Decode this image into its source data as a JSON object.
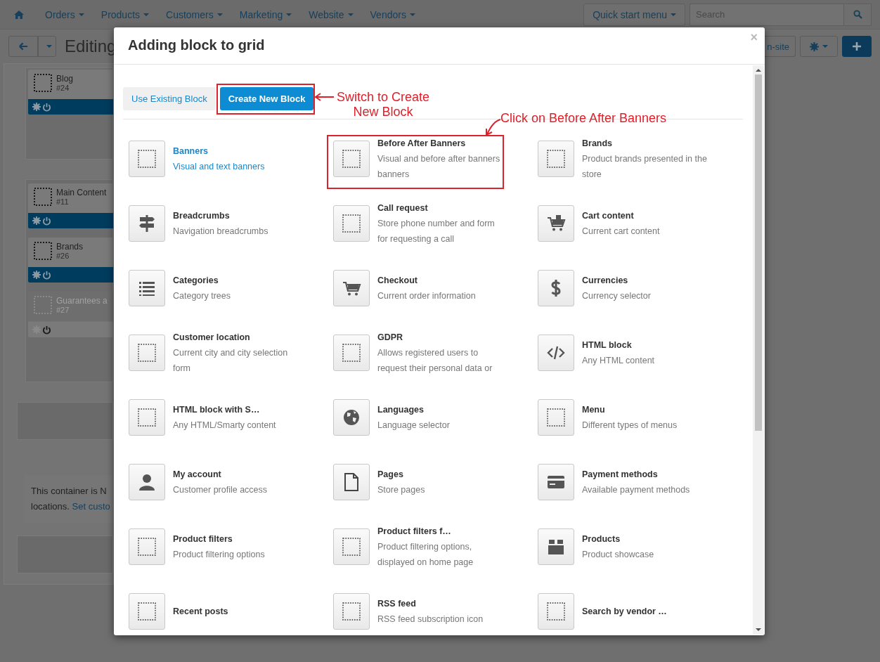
{
  "navbar": {
    "items": [
      {
        "label": "Orders"
      },
      {
        "label": "Products"
      },
      {
        "label": "Customers"
      },
      {
        "label": "Marketing"
      },
      {
        "label": "Website"
      },
      {
        "label": "Vendors"
      }
    ],
    "quick_start": "Quick start menu",
    "search": {
      "placeholder": "Search"
    }
  },
  "toolbar": {
    "title": "Editing",
    "view_button": "n-site"
  },
  "layout": {
    "sections": [
      {
        "blocks": [
          {
            "name": "Blog",
            "id": "#24",
            "enabled": true
          }
        ]
      },
      {
        "blocks": [
          {
            "name": "Main Content",
            "id": "#11",
            "enabled": true
          },
          {
            "name": "Brands",
            "id": "#26",
            "enabled": true
          },
          {
            "name": "Guarantees a",
            "id": "#27",
            "enabled": false
          }
        ]
      }
    ],
    "notice": {
      "line1": "This container is N",
      "line2": "locations.",
      "link": "Set custo"
    }
  },
  "modal": {
    "title": "Adding block to grid",
    "close": "×",
    "tabs": [
      {
        "label": "Use Existing Block",
        "selected": false
      },
      {
        "label": "Create New Block",
        "selected": true
      }
    ],
    "blocks": [
      {
        "kind": "placeholder",
        "title": "Banners",
        "description": "Visual and text banners",
        "selected": true
      },
      {
        "kind": "placeholder",
        "title": "Before After Banners",
        "description": "Visual and before after banners banners",
        "selected": false
      },
      {
        "kind": "placeholder",
        "title": "Brands",
        "description": "Product brands presented in the store",
        "selected": false
      },
      {
        "kind": "signpost",
        "title": "Breadcrumbs",
        "description": "Navigation breadcrumbs",
        "selected": false
      },
      {
        "kind": "placeholder",
        "title": "Call request",
        "description": "Store phone number and form for requesting a call",
        "selected": false
      },
      {
        "kind": "cart-plus",
        "title": "Cart content",
        "description": "Current cart content",
        "selected": false
      },
      {
        "kind": "list",
        "title": "Categories",
        "description": "Category trees",
        "selected": false
      },
      {
        "kind": "cart",
        "title": "Checkout",
        "description": "Current order information",
        "selected": false
      },
      {
        "kind": "dollar",
        "title": "Currencies",
        "description": "Currency selector",
        "selected": false
      },
      {
        "kind": "placeholder",
        "title": "Customer location",
        "description": "Current city and city selection form",
        "selected": false
      },
      {
        "kind": "placeholder",
        "title": "GDPR",
        "description": "Allows registered users to request their personal data or",
        "selected": false
      },
      {
        "kind": "code",
        "title": "HTML block",
        "description": "Any HTML content",
        "selected": false
      },
      {
        "kind": "placeholder",
        "title": "HTML block with S…",
        "description": "Any HTML/Smarty content",
        "selected": false
      },
      {
        "kind": "globe",
        "title": "Languages",
        "description": "Language selector",
        "selected": false
      },
      {
        "kind": "placeholder",
        "title": "Menu",
        "description": "Different types of menus",
        "selected": false
      },
      {
        "kind": "person",
        "title": "My account",
        "description": "Customer profile access",
        "selected": false
      },
      {
        "kind": "page",
        "title": "Pages",
        "description": "Store pages",
        "selected": false
      },
      {
        "kind": "card",
        "title": "Payment methods",
        "description": "Available payment methods",
        "selected": false
      },
      {
        "kind": "placeholder",
        "title": "Product filters",
        "description": "Product filtering options",
        "selected": false
      },
      {
        "kind": "placeholder",
        "title": "Product filters f…",
        "description": "Product filtering options, displayed on home page",
        "selected": false
      },
      {
        "kind": "box",
        "title": "Products",
        "description": "Product showcase",
        "selected": false
      },
      {
        "kind": "placeholder",
        "title": "Recent posts",
        "selected": false
      },
      {
        "kind": "placeholder",
        "title": "RSS feed",
        "description": "RSS feed subscription icon",
        "selected": false
      },
      {
        "kind": "placeholder",
        "title": "Search by vendor …",
        "selected": false
      }
    ]
  },
  "annotations": [
    {
      "text": "Switch to Create New Block"
    },
    {
      "text": "Click on Before After Banners"
    }
  ]
}
